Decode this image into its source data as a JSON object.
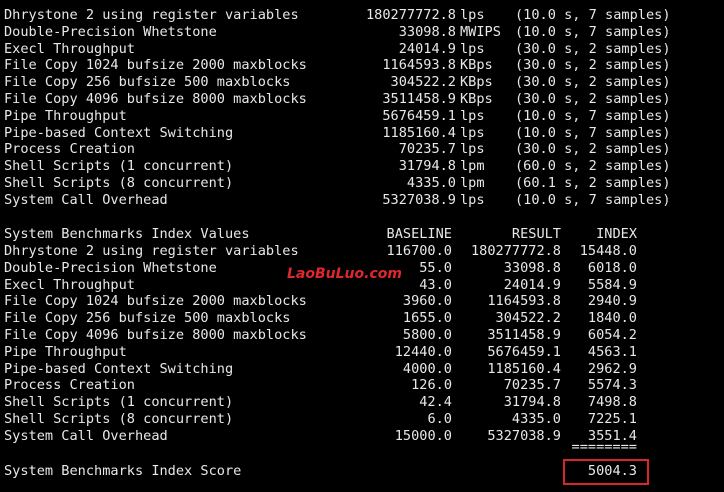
{
  "colors": {
    "background": "#000000",
    "text": "#e8e8e8",
    "watermark": "#e0262e",
    "highlight_box": "#d8262b"
  },
  "raw_results": [
    {
      "name": "Dhrystone 2 using register variables",
      "value": "180277772.8",
      "unit": "lps",
      "detail": "(10.0 s, 7 samples)"
    },
    {
      "name": "Double-Precision Whetstone",
      "value": "33098.8",
      "unit": "MWIPS",
      "detail": "(10.0 s, 7 samples)"
    },
    {
      "name": "Execl Throughput",
      "value": "24014.9",
      "unit": "lps",
      "detail": "(30.0 s, 2 samples)"
    },
    {
      "name": "File Copy 1024 bufsize 2000 maxblocks",
      "value": "1164593.8",
      "unit": "KBps",
      "detail": "(30.0 s, 2 samples)"
    },
    {
      "name": "File Copy 256 bufsize 500 maxblocks",
      "value": "304522.2",
      "unit": "KBps",
      "detail": "(30.0 s, 2 samples)"
    },
    {
      "name": "File Copy 4096 bufsize 8000 maxblocks",
      "value": "3511458.9",
      "unit": "KBps",
      "detail": "(30.0 s, 2 samples)"
    },
    {
      "name": "Pipe Throughput",
      "value": "5676459.1",
      "unit": "lps",
      "detail": "(10.0 s, 7 samples)"
    },
    {
      "name": "Pipe-based Context Switching",
      "value": "1185160.4",
      "unit": "lps",
      "detail": "(10.0 s, 7 samples)"
    },
    {
      "name": "Process Creation",
      "value": "70235.7",
      "unit": "lps",
      "detail": "(30.0 s, 2 samples)"
    },
    {
      "name": "Shell Scripts (1 concurrent)",
      "value": "31794.8",
      "unit": "lpm",
      "detail": "(60.0 s, 2 samples)"
    },
    {
      "name": "Shell Scripts (8 concurrent)",
      "value": "4335.0",
      "unit": "lpm",
      "detail": "(60.1 s, 2 samples)"
    },
    {
      "name": "System Call Overhead",
      "value": "5327038.9",
      "unit": "lps",
      "detail": "(10.0 s, 7 samples)"
    }
  ],
  "index_table": {
    "title": "System Benchmarks Index Values",
    "col_baseline": "BASELINE",
    "col_result": "RESULT",
    "col_index": "INDEX",
    "rows": [
      {
        "name": "Dhrystone 2 using register variables",
        "baseline": "116700.0",
        "result": "180277772.8",
        "index": "15448.0"
      },
      {
        "name": "Double-Precision Whetstone",
        "baseline": "55.0",
        "result": "33098.8",
        "index": "6018.0"
      },
      {
        "name": "Execl Throughput",
        "baseline": "43.0",
        "result": "24014.9",
        "index": "5584.9"
      },
      {
        "name": "File Copy 1024 bufsize 2000 maxblocks",
        "baseline": "3960.0",
        "result": "1164593.8",
        "index": "2940.9"
      },
      {
        "name": "File Copy 256 bufsize 500 maxblocks",
        "baseline": "1655.0",
        "result": "304522.2",
        "index": "1840.0"
      },
      {
        "name": "File Copy 4096 bufsize 8000 maxblocks",
        "baseline": "5800.0",
        "result": "3511458.9",
        "index": "6054.2"
      },
      {
        "name": "Pipe Throughput",
        "baseline": "12440.0",
        "result": "5676459.1",
        "index": "4563.1"
      },
      {
        "name": "Pipe-based Context Switching",
        "baseline": "4000.0",
        "result": "1185160.4",
        "index": "2962.9"
      },
      {
        "name": "Process Creation",
        "baseline": "126.0",
        "result": "70235.7",
        "index": "5574.3"
      },
      {
        "name": "Shell Scripts (1 concurrent)",
        "baseline": "42.4",
        "result": "31794.8",
        "index": "7498.8"
      },
      {
        "name": "Shell Scripts (8 concurrent)",
        "baseline": "6.0",
        "result": "4335.0",
        "index": "7225.1"
      },
      {
        "name": "System Call Overhead",
        "baseline": "15000.0",
        "result": "5327038.9",
        "index": "3551.4"
      }
    ],
    "separator": "========",
    "score_label": "System Benchmarks Index Score",
    "score_value": "5004.3"
  },
  "watermark": "LaoBuLuo.com"
}
